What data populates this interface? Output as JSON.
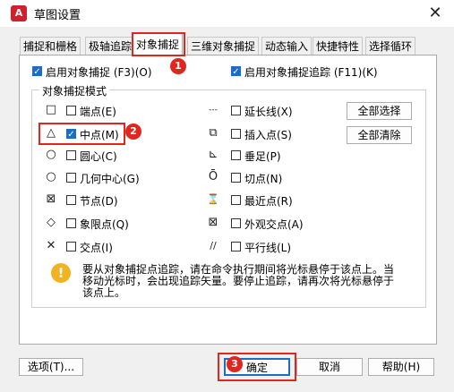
{
  "window": {
    "title": "草图设置",
    "app_icon_text": "A",
    "close_label": "✕"
  },
  "tabs": [
    {
      "label": "捕捉和栅格"
    },
    {
      "label": "极轴追踪"
    },
    {
      "label": "对象捕捉"
    },
    {
      "label": "三维对象捕捉"
    },
    {
      "label": "动态输入"
    },
    {
      "label": "快捷特性"
    },
    {
      "label": "选择循环"
    }
  ],
  "top_options": {
    "enable_osnap": {
      "label": "启用对象捕捉 (F3)(O)",
      "checked": true
    },
    "enable_tracking": {
      "label": "启用对象捕捉追踪 (F11)(K)",
      "checked": true
    }
  },
  "group": {
    "title": "对象捕捉模式"
  },
  "modes_left": [
    {
      "symbol": "□",
      "label": "端点(E)",
      "checked": false
    },
    {
      "symbol": "△",
      "label": "中点(M)",
      "checked": true
    },
    {
      "symbol": "○",
      "label": "圆心(C)",
      "checked": false
    },
    {
      "symbol": "○",
      "label": "几何中心(G)",
      "checked": false
    },
    {
      "symbol": "⊠",
      "label": "节点(D)",
      "checked": false
    },
    {
      "symbol": "◇",
      "label": "象限点(Q)",
      "checked": false
    },
    {
      "symbol": "✕",
      "label": "交点(I)",
      "checked": false
    }
  ],
  "modes_right": [
    {
      "symbol": "---",
      "label": "延长线(X)",
      "checked": false
    },
    {
      "symbol": "⧉",
      "label": "插入点(S)",
      "checked": false
    },
    {
      "symbol": "⊾",
      "label": "垂足(P)",
      "checked": false
    },
    {
      "symbol": "Ō",
      "label": "切点(N)",
      "checked": false
    },
    {
      "symbol": "⌛",
      "label": "最近点(R)",
      "checked": false
    },
    {
      "symbol": "⊠",
      "label": "外观交点(A)",
      "checked": false
    },
    {
      "symbol": "//",
      "label": "平行线(L)",
      "checked": false
    }
  ],
  "buttons": {
    "select_all": "全部选择",
    "clear_all": "全部清除",
    "options": "选项(T)...",
    "ok": "确定",
    "cancel": "取消",
    "help": "帮助(H)"
  },
  "info": {
    "icon": "!",
    "line1": "要从对象捕捉点追踪，请在命令执行期间将光标悬停于该点上。当",
    "line2": "移动光标时，会出现追踪矢量。要停止追踪，请再次将光标悬停于",
    "line3": "该点上。"
  },
  "annotations": {
    "badge1": "1",
    "badge2": "2",
    "badge3": "3",
    "color": "#e0261f"
  }
}
